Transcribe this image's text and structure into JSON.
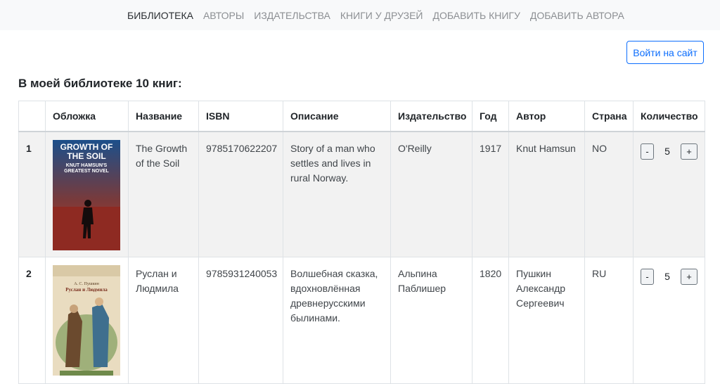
{
  "nav": {
    "items": [
      {
        "label": "Библиотека",
        "active": true
      },
      {
        "label": "Авторы",
        "active": false
      },
      {
        "label": "Издательства",
        "active": false
      },
      {
        "label": "Книги у друзей",
        "active": false
      },
      {
        "label": "Добавить книгу",
        "active": false
      },
      {
        "label": "Добавить автора",
        "active": false
      }
    ]
  },
  "header": {
    "login_label": "Войти на сайт"
  },
  "main": {
    "title": "В моей библиотеке 10 книг:"
  },
  "table": {
    "columns": [
      "",
      "Обложка",
      "Название",
      "ISBN",
      "Описание",
      "Издательство",
      "Год",
      "Автор",
      "Страна",
      "Количество"
    ],
    "rows": [
      {
        "num": "1",
        "cover_text": [
          "GROWTH OF",
          "THE SOIL",
          "KNUT HAMSUN'S",
          "GREATEST NOVEL"
        ],
        "title": "The Growth of the Soil",
        "isbn": "9785170622207",
        "description": "Story of a man who settles and lives in rural Norway.",
        "publisher": "O'Reilly",
        "year": "1917",
        "author": "Knut Hamsun",
        "country": "NO",
        "minus": "-",
        "qty": "5",
        "plus": "+"
      },
      {
        "num": "2",
        "cover_text": [
          "А. С. Пушкин",
          "Руслан и Людмила"
        ],
        "title": "Руслан и Людмила",
        "isbn": "9785931240053",
        "description": "Волшебная сказка, вдохновлённая древнерусскими былинами.",
        "publisher": "Альпина Паблишер",
        "year": "1820",
        "author": "Пушкин Александр Сергеевич",
        "country": "RU",
        "minus": "-",
        "qty": "5",
        "plus": "+"
      }
    ]
  }
}
